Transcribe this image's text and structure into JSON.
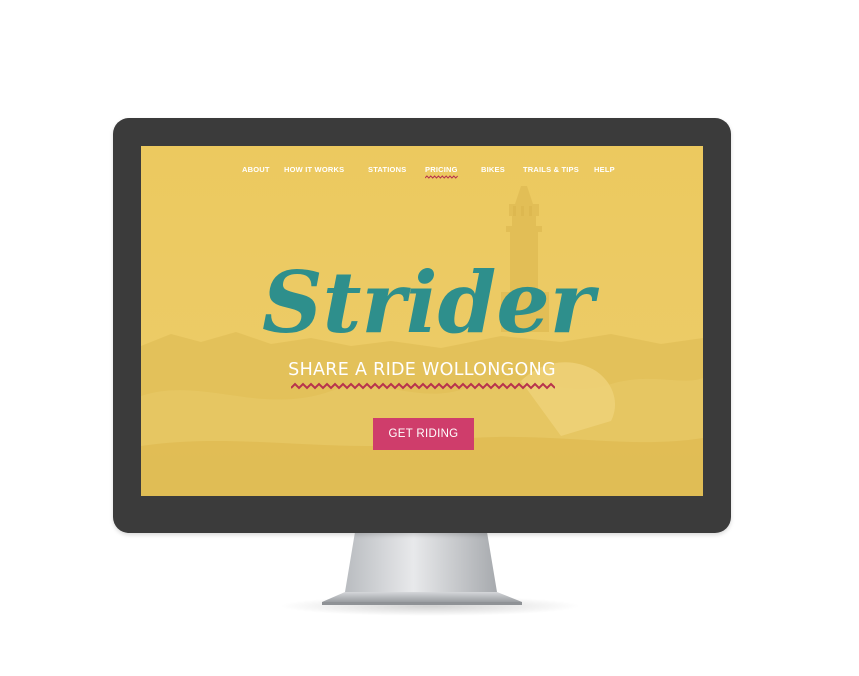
{
  "nav": {
    "items": [
      {
        "label": "ABOUT"
      },
      {
        "label": "HOW IT WORKS"
      },
      {
        "label": "STATIONS"
      },
      {
        "label": "PRICING",
        "active": true
      },
      {
        "label": "BIKES"
      },
      {
        "label": "TRAILS & TIPS"
      },
      {
        "label": "HELP"
      }
    ]
  },
  "hero": {
    "logo_text": "Strider",
    "tagline": "SHARE A RIDE WOLLONGONG",
    "cta_label": "GET RIDING"
  },
  "colors": {
    "background": "#e9c964",
    "logo": "#2e8f8c",
    "accent_zigzag": "#b8334d",
    "cta": "#cf3d6b",
    "bezel": "#3b3b3b"
  }
}
